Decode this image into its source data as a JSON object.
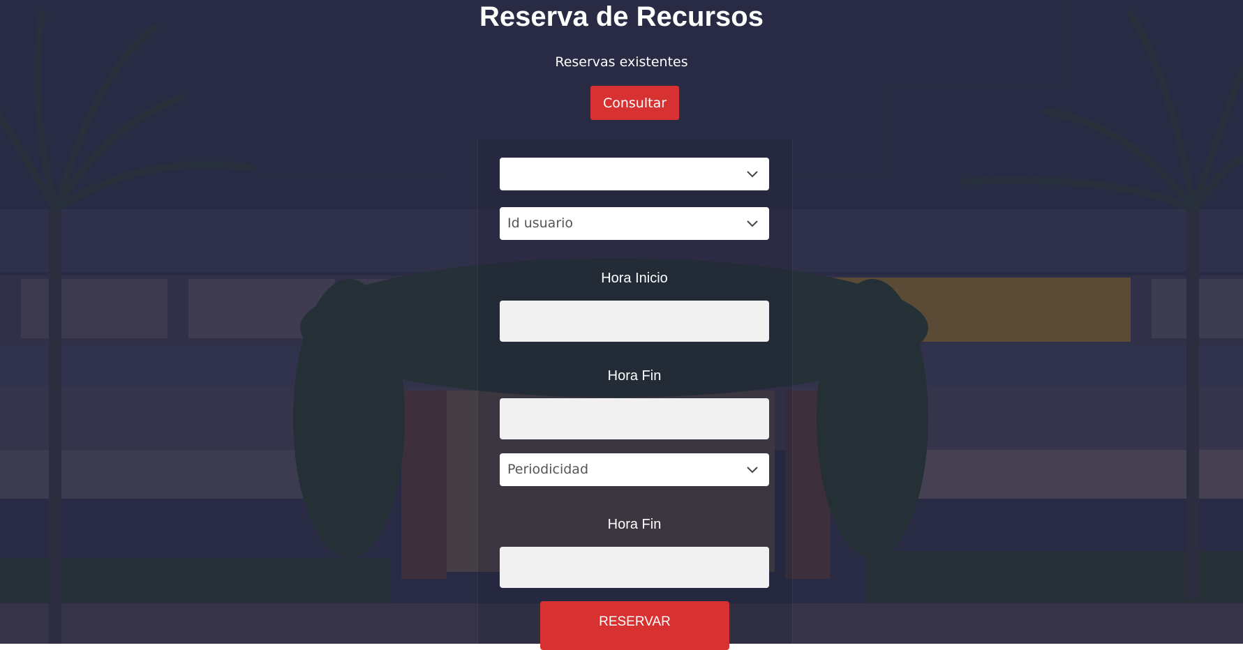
{
  "page": {
    "title": "Reserva de Recursos",
    "subtitle": "Reservas existentes"
  },
  "buttons": {
    "consult_label": "Consultar",
    "reserve_label": "RESERVAR"
  },
  "form": {
    "resource_select": {
      "value": ""
    },
    "user_select": {
      "value": "Id usuario"
    },
    "start_label": "Hora Inicio",
    "end_label": "Hora Fin",
    "periodicity_select": {
      "value": "Periodicidad"
    },
    "end_label_2": "Hora Fin"
  },
  "colors": {
    "accent": "#d83131",
    "overlay": "#262842",
    "input_bg": "#f1f1f1"
  },
  "icons": {
    "dropdown": "chevron-down-icon"
  }
}
